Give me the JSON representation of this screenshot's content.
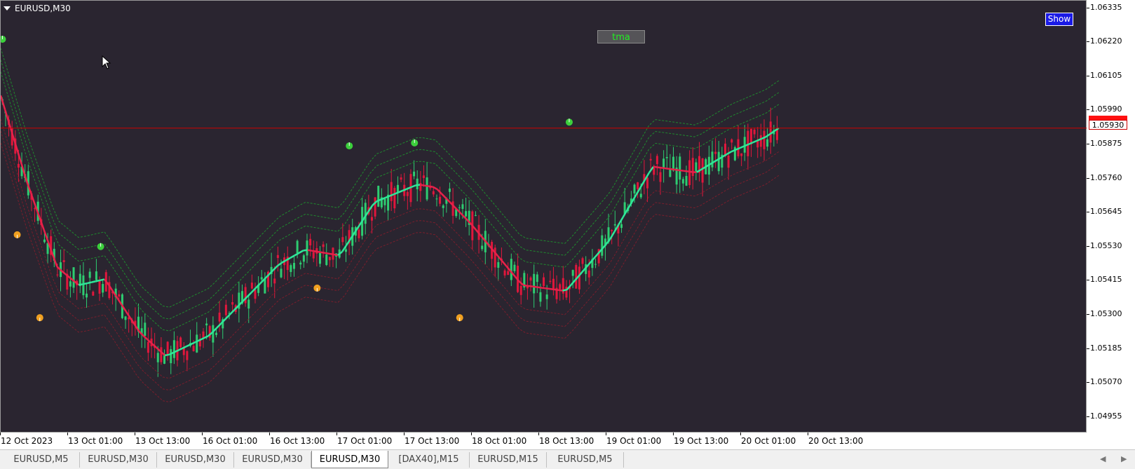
{
  "chart": {
    "symbol_title": "EURUSD,M30",
    "background": "#2a2530",
    "bull_color": "#2ecc71",
    "bear_color": "#e0173c",
    "tma_button_label": "tma",
    "show_button_label": "Show",
    "current_price_label": "1.05930"
  },
  "price_axis": {
    "labels": [
      "1.06335",
      "1.06220",
      "1.06105",
      "1.05990",
      "1.05875",
      "1.05760",
      "1.05645",
      "1.05530",
      "1.05415",
      "1.05300",
      "1.05185",
      "1.05070",
      "1.04955"
    ]
  },
  "time_axis": {
    "labels": [
      "12 Oct 2023",
      "13 Oct 01:00",
      "13 Oct 13:00",
      "16 Oct 01:00",
      "16 Oct 13:00",
      "17 Oct 01:00",
      "17 Oct 13:00",
      "18 Oct 01:00",
      "18 Oct 13:00",
      "19 Oct 01:00",
      "19 Oct 13:00",
      "20 Oct 01:00",
      "20 Oct 13:00"
    ]
  },
  "tabs": [
    {
      "label": "EURUSD,M5",
      "active": false
    },
    {
      "label": "EURUSD,M30",
      "active": false
    },
    {
      "label": "EURUSD,M30",
      "active": false
    },
    {
      "label": "EURUSD,M30",
      "active": false
    },
    {
      "label": "EURUSD,M30",
      "active": true
    },
    {
      "label": "[DAX40],M15",
      "active": false
    },
    {
      "label": "EURUSD,M15",
      "active": false
    },
    {
      "label": "EURUSD,M5",
      "active": false
    }
  ],
  "chart_data": {
    "type": "candlestick",
    "title": "EURUSD,M30",
    "ylim": [
      1.049,
      1.0636
    ],
    "current_price": 1.0593,
    "tma_midline": [
      {
        "x": 0,
        "y": 1.0604
      },
      {
        "x": 0.03,
        "y": 1.0575
      },
      {
        "x": 0.065,
        "y": 1.0546
      },
      {
        "x": 0.09,
        "y": 1.054
      },
      {
        "x": 0.12,
        "y": 1.0542
      },
      {
        "x": 0.16,
        "y": 1.0524
      },
      {
        "x": 0.19,
        "y": 1.0516
      },
      {
        "x": 0.24,
        "y": 1.0523
      },
      {
        "x": 0.32,
        "y": 1.0547
      },
      {
        "x": 0.35,
        "y": 1.0552
      },
      {
        "x": 0.39,
        "y": 1.055
      },
      {
        "x": 0.43,
        "y": 1.0568
      },
      {
        "x": 0.48,
        "y": 1.0574
      },
      {
        "x": 0.5,
        "y": 1.0573
      },
      {
        "x": 0.54,
        "y": 1.0561
      },
      {
        "x": 0.6,
        "y": 1.054
      },
      {
        "x": 0.65,
        "y": 1.0538
      },
      {
        "x": 0.7,
        "y": 1.0555
      },
      {
        "x": 0.75,
        "y": 1.058
      },
      {
        "x": 0.8,
        "y": 1.0578
      },
      {
        "x": 0.84,
        "y": 1.0585
      },
      {
        "x": 0.88,
        "y": 1.059
      },
      {
        "x": 0.895,
        "y": 1.0593
      }
    ],
    "signals": [
      {
        "type": "buy",
        "x": 0.002,
        "y": 1.0623
      },
      {
        "type": "sell",
        "x": 0.019,
        "y": 1.0557
      },
      {
        "type": "sell",
        "x": 0.045,
        "y": 1.0529
      },
      {
        "type": "buy",
        "x": 0.115,
        "y": 1.0553
      },
      {
        "type": "sell",
        "x": 0.364,
        "y": 1.0539
      },
      {
        "type": "buy",
        "x": 0.401,
        "y": 1.0587
      },
      {
        "type": "buy",
        "x": 0.476,
        "y": 1.0588
      },
      {
        "type": "sell",
        "x": 0.528,
        "y": 1.0529
      },
      {
        "type": "buy",
        "x": 0.654,
        "y": 1.0595
      }
    ]
  }
}
